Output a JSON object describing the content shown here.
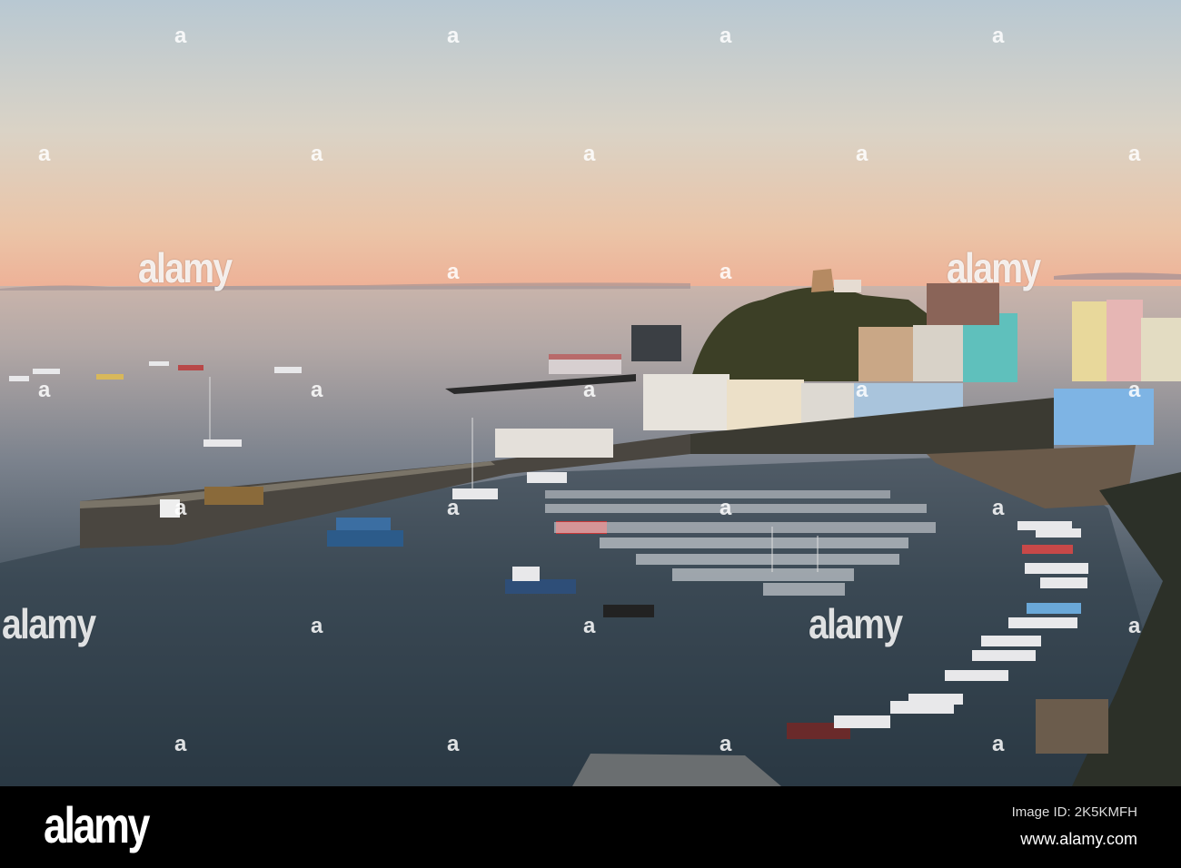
{
  "watermark": {
    "word": "alamy",
    "logo_letter": "a"
  },
  "footer": {
    "logo": "alamy",
    "image_id": "Image ID: 2K5KMFH",
    "url": "www.alamy.com"
  }
}
